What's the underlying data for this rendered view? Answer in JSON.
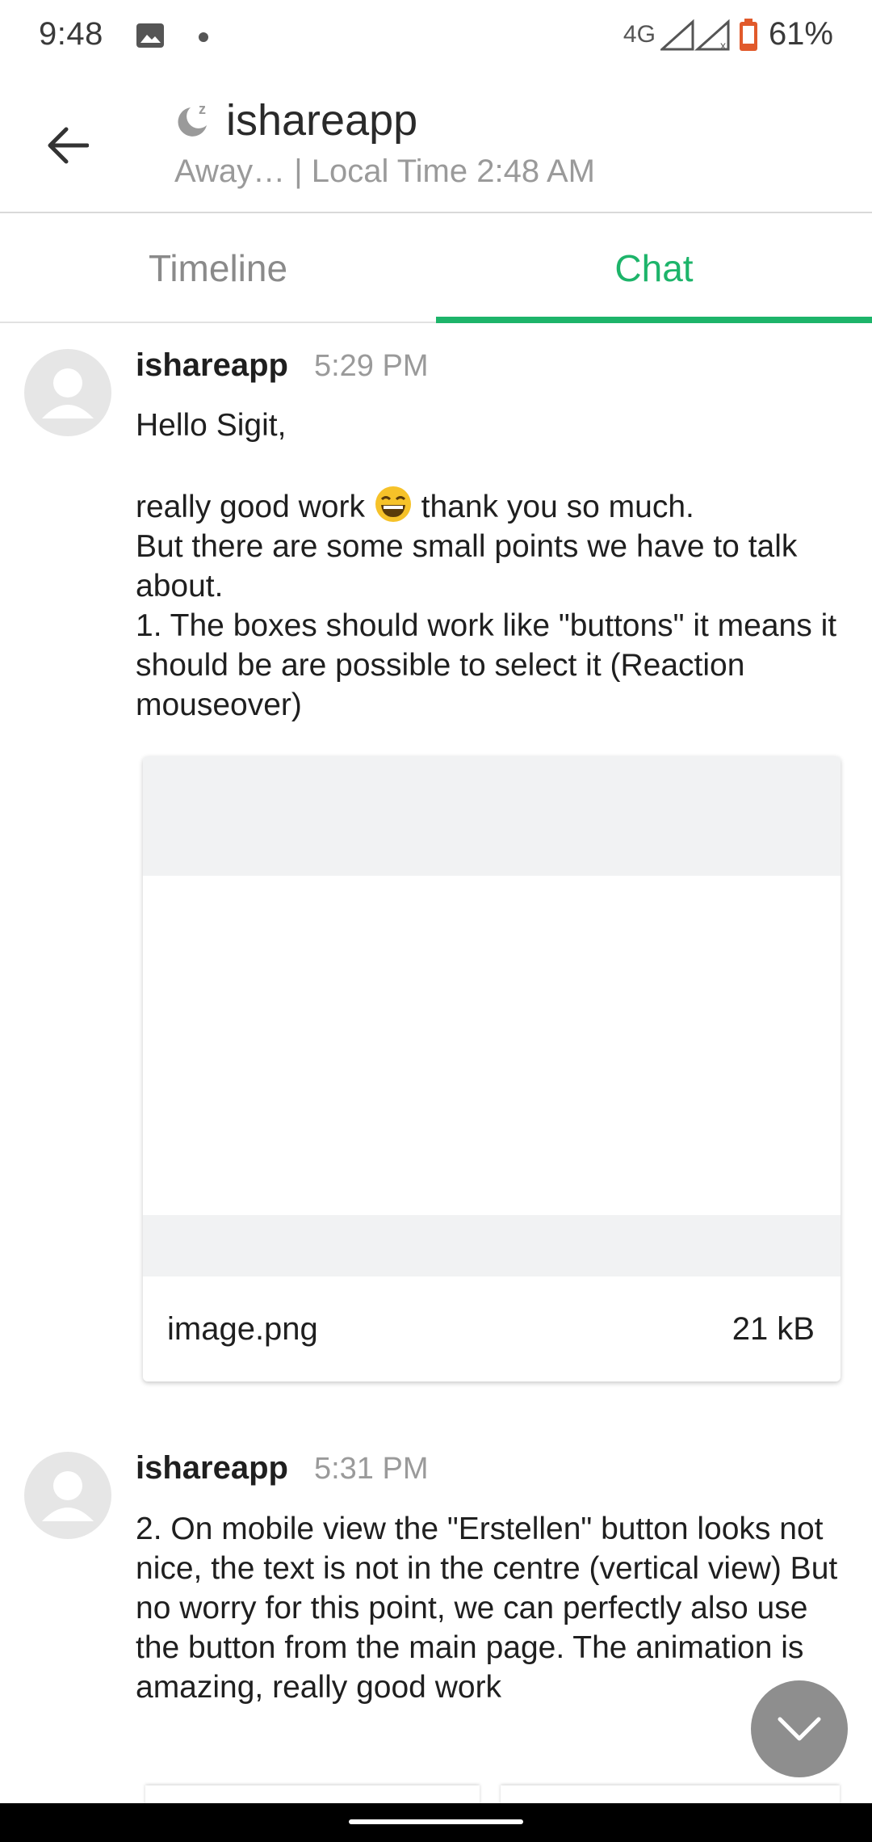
{
  "status_bar": {
    "time": "9:48",
    "network": "4G",
    "battery_percent": "61%",
    "icons": [
      "image-icon",
      "dot-icon",
      "network-icon",
      "signal-icon",
      "battery-icon"
    ]
  },
  "header": {
    "title": "ishareapp",
    "subtitle": "Away… | Local Time 2:48 AM",
    "status_icon": "moon-sleep-icon",
    "back_icon": "arrow-left-icon"
  },
  "tabs": [
    {
      "label": "Timeline",
      "active": false
    },
    {
      "label": "Chat",
      "active": true
    }
  ],
  "colors": {
    "accent": "#1db46a",
    "muted_text": "#9a9a9a",
    "avatar_bg": "#e6e6e6",
    "scroll_button": "#8e8e8e"
  },
  "messages": [
    {
      "author": "ishareapp",
      "time": "5:29 PM",
      "line1": "Hello Sigit,",
      "line2_before": "really good work",
      "emoji": "😄",
      "line2_after": "thank you so much.",
      "line3": "But there are some small points we have to talk about.",
      "line4": "1. The boxes should work like \"buttons\" it means it should be are possible to select it (Reaction mouseover)",
      "attachment": {
        "name": "image.png",
        "size": "21 kB"
      }
    },
    {
      "author": "ishareapp",
      "time": "5:31 PM",
      "text": "2. On mobile view the \"Erstellen\" button looks not nice, the text is not in the centre (vertical view) But no worry for this point, we can perfectly also use the button from the main page. The animation is amazing, really good work"
    }
  ]
}
